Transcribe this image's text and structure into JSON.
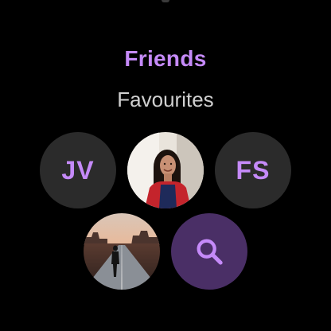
{
  "screen": {
    "title": "Friends",
    "subtitle": "Favourites"
  },
  "contacts": [
    {
      "type": "initials",
      "text": "JV"
    },
    {
      "type": "photo",
      "icon": "person-photo"
    },
    {
      "type": "initials",
      "text": "FS"
    },
    {
      "type": "photo",
      "icon": "road-landscape-photo"
    }
  ],
  "actions": {
    "search_icon": "search-icon"
  },
  "colors": {
    "accent": "#c58af9",
    "chip_background": "#2b2b2b",
    "search_background": "#4a2f66",
    "subtitle": "#d0d0d0",
    "background": "#000000"
  }
}
